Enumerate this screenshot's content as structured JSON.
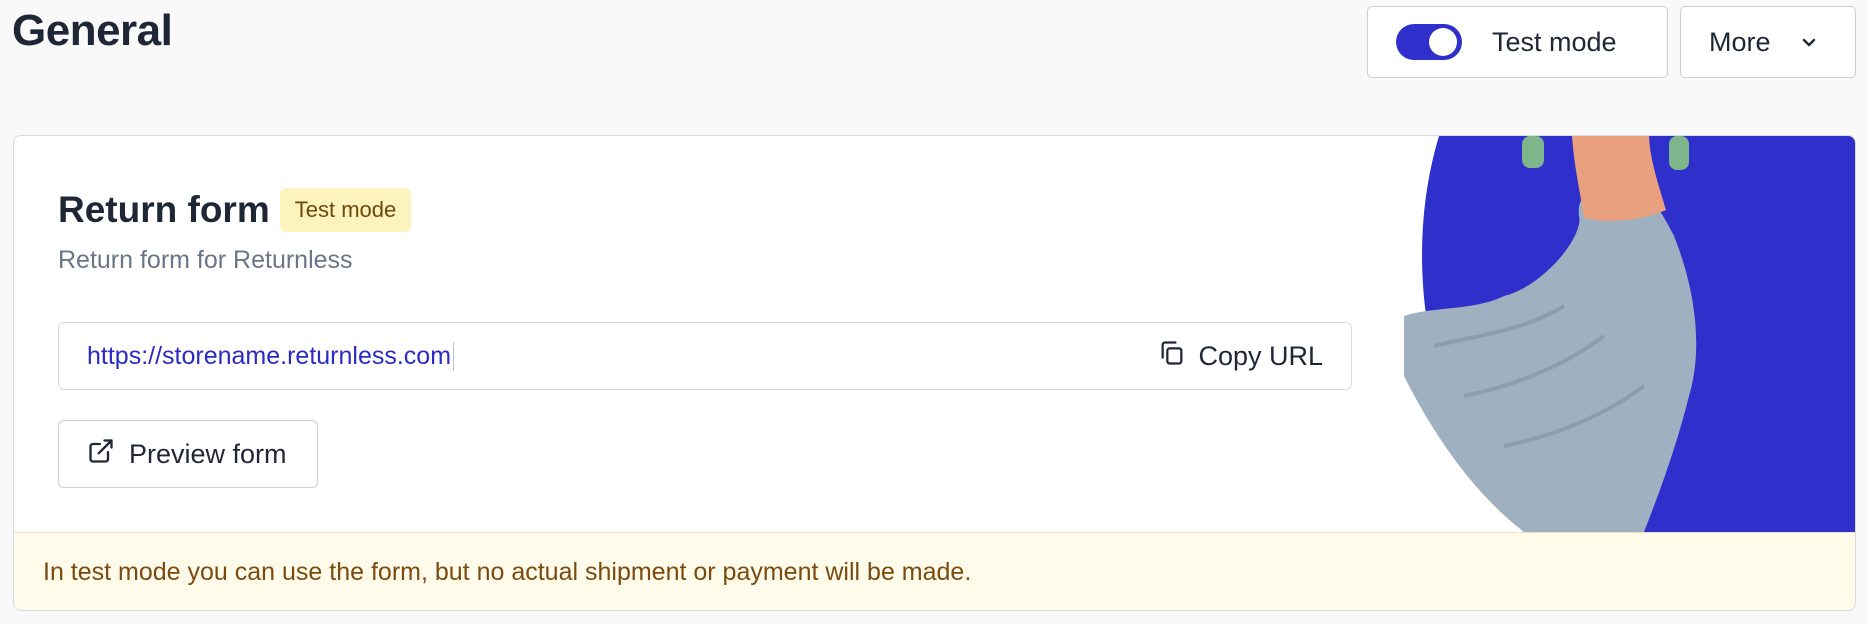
{
  "header": {
    "title": "General",
    "test_mode_toggle": {
      "label": "Test mode",
      "on": true
    },
    "more": {
      "label": "More",
      "icon": "chevron-down-icon"
    }
  },
  "card": {
    "title": "Return form",
    "badge": "Test mode",
    "subtitle": "Return form for Returnless",
    "url": {
      "value": "https://storename.returnless.com",
      "copy_label": "Copy URL",
      "copy_icon": "copy-icon"
    },
    "preview": {
      "label": "Preview form",
      "icon": "external-link-icon"
    },
    "notice": "In test mode you can use the form, but no actual shipment or payment will be made."
  },
  "colors": {
    "accent": "#2f2fcc",
    "badge_bg": "#fdf3bd",
    "notice_bg": "#fefbeb",
    "notice_text": "#7a4a0f"
  }
}
